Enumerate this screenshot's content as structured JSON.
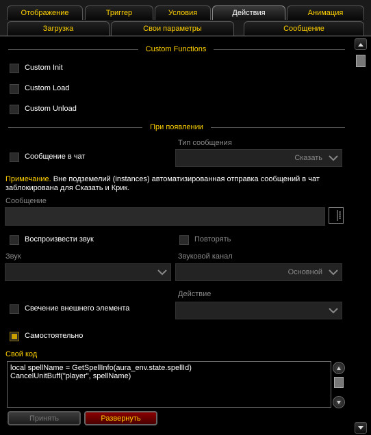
{
  "tabs_row1": [
    "Отображение",
    "Триггер",
    "Условия",
    "Действия",
    "Анимация"
  ],
  "tabs_row2": [
    "Загрузка",
    "Свои параметры",
    "Сообщение"
  ],
  "active_tab": "Действия",
  "custom_functions": {
    "title": "Custom Functions",
    "init": "Custom Init",
    "load": "Custom Load",
    "unload": "Custom Unload"
  },
  "on_show": {
    "title": "При появлении",
    "chat_message": "Сообщение в чат",
    "message_type_label": "Тип сообщения",
    "message_type_value": "Сказать",
    "note_prefix": "Примечание.",
    "note_text": " Вне подземелий (instances) автоматизированная отправка сообщений в чат заблокирована для Сказать и Крик.",
    "message_label": "Сообщение",
    "message_value": "",
    "play_sound": "Воспроизвести звук",
    "repeat": "Повторять",
    "sound_label": "Звук",
    "sound_value": "",
    "sound_channel_label": "Звуковой канал",
    "sound_channel_value": "Основной",
    "action_label": "Действие",
    "action_value": "",
    "glow": "Свечение внешнего элемента",
    "standalone": "Самостоятельно",
    "custom_code_label": "Свой код",
    "custom_code": "local spellName = GetSpellInfo(aura_env.state.spellId)\nCancelUnitBuff(\"player\", spellName)",
    "accept_button": "Принять",
    "expand_button": "Развернуть"
  },
  "checkbox_states": {
    "init": false,
    "load": false,
    "unload": false,
    "chat_message": false,
    "play_sound": false,
    "repeat": false,
    "glow": false,
    "standalone": true
  }
}
